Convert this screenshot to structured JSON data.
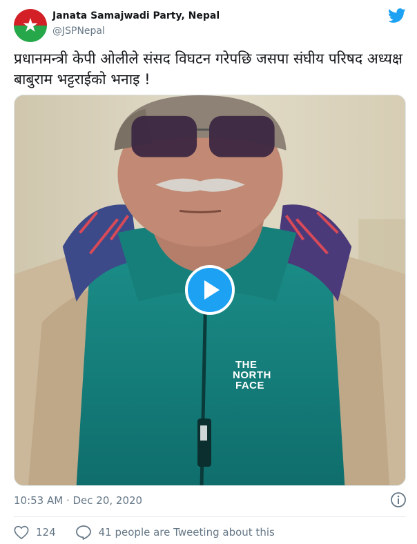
{
  "author": {
    "name": "Janata Samajwadi Party, Nepal",
    "handle": "@JSPNepal",
    "avatar_colors": {
      "top": "#d31f26",
      "bottom": "#26a84a",
      "star": "#ffffff"
    }
  },
  "tweet": {
    "text": "प्रधानमन्त्री केपी ओलीले संसद विघटन गरेपछि जसपा संघीय परिषद अध्यक्ष बाबुराम भट्टराईको भनाइ !",
    "media": {
      "type": "video",
      "play_icon": "play-icon",
      "visible_brand_text": [
        "THE",
        "NORTH",
        "FACE"
      ]
    },
    "timestamp": "10:53 AM · Dec 20, 2020"
  },
  "actions": {
    "likes": "124",
    "conversation": "41 people are Tweeting about this"
  },
  "icons": {
    "brand": "twitter-bird-icon",
    "info": "info-icon",
    "like": "heart-icon",
    "conversation": "speech-bubble-icon"
  },
  "colors": {
    "accent": "#1da1f2",
    "muted": "#657786",
    "text": "#14171a",
    "border": "#e1e8ed"
  }
}
